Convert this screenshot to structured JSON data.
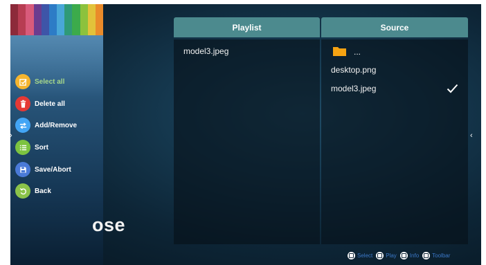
{
  "menu": {
    "items": [
      {
        "label": "Select all",
        "icon": "select-all-icon",
        "color": "#f5b52f"
      },
      {
        "label": "Delete all",
        "icon": "trash-icon",
        "color": "#e53935"
      },
      {
        "label": "Add/Remove",
        "icon": "swap-icon",
        "color": "#42a5f5"
      },
      {
        "label": "Sort",
        "icon": "list-icon",
        "color": "#7cc340"
      },
      {
        "label": "Save/Abort",
        "icon": "save-icon",
        "color": "#4a7ad8"
      },
      {
        "label": "Back",
        "icon": "back-icon",
        "color": "#8bc34a"
      }
    ]
  },
  "background_text": "ose",
  "playlist": {
    "header": "Playlist",
    "items": [
      "model3.jpeg"
    ]
  },
  "source": {
    "header": "Source",
    "folder_label": "...",
    "items": [
      "desktop.png",
      "model3.jpeg"
    ],
    "checked_item": "model3.jpeg"
  },
  "hints": [
    {
      "label": "Select"
    },
    {
      "label": "Play"
    },
    {
      "label": "Info"
    },
    {
      "label": "Toolbar"
    }
  ],
  "colors": {
    "header_teal": "#4c8a8e",
    "active_menu_text": "#a7d88a",
    "hint_text": "#3b78c8"
  }
}
